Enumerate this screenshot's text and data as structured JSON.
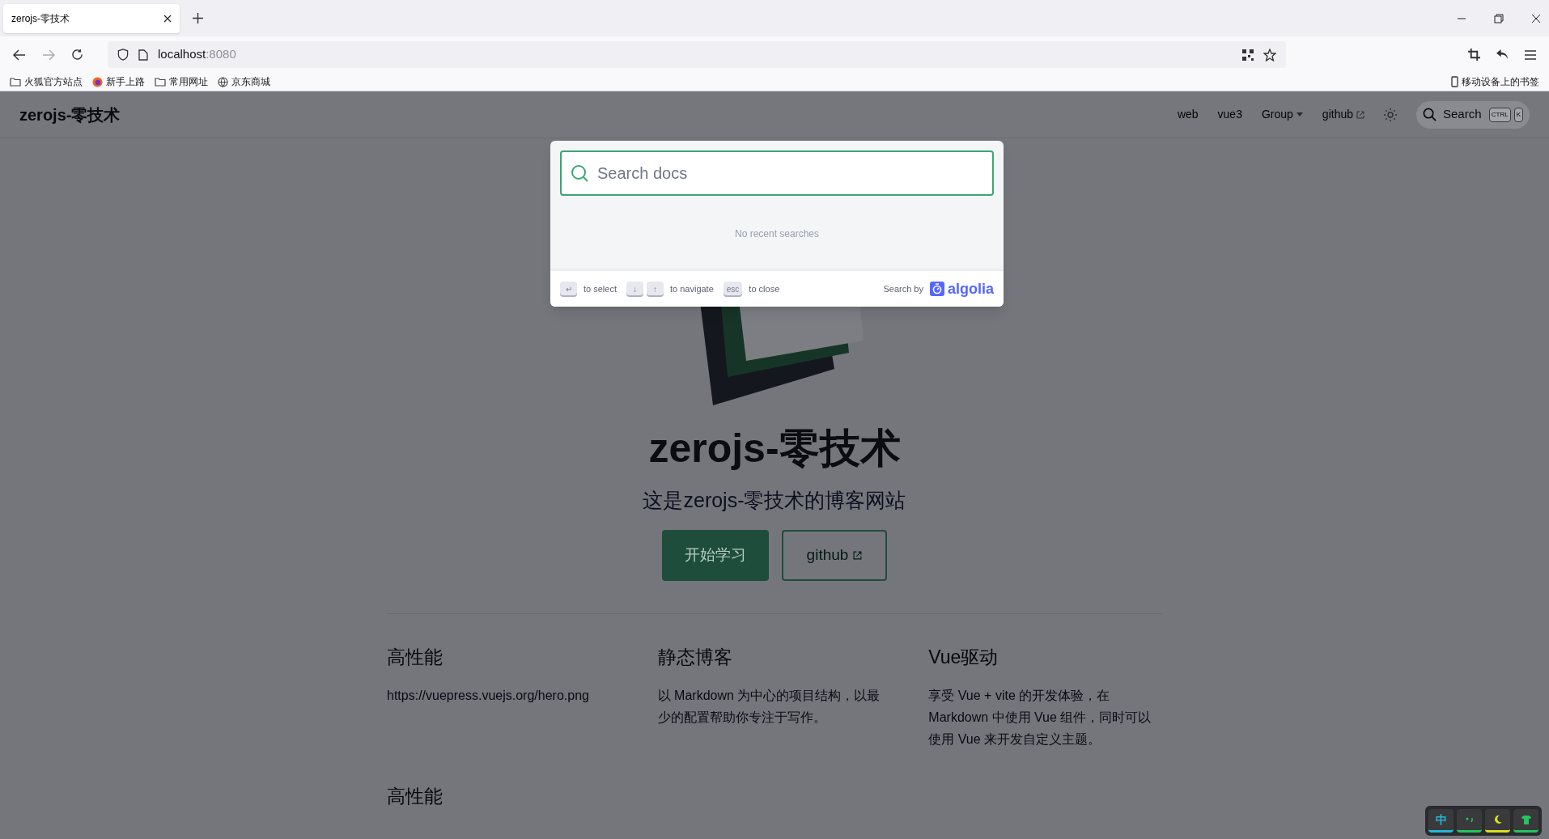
{
  "browser": {
    "tab": {
      "title": "zerojs-零技术"
    },
    "address": {
      "host": "localhost",
      "port": ":8080"
    },
    "bookmarks": [
      {
        "label": "火狐官方站点",
        "kind": "folder"
      },
      {
        "label": "新手上路",
        "kind": "firefox"
      },
      {
        "label": "常用网址",
        "kind": "folder"
      },
      {
        "label": "京东商城",
        "kind": "globe"
      }
    ],
    "mobile_bookmarks": "移动设备上的书签"
  },
  "site": {
    "logo": "zerojs-零技术",
    "nav": [
      {
        "label": "web",
        "kind": "link"
      },
      {
        "label": "vue3",
        "kind": "link"
      },
      {
        "label": "Group",
        "kind": "dropdown"
      },
      {
        "label": "github",
        "kind": "external"
      }
    ],
    "search": {
      "placeholder": "Search",
      "keys": [
        "CTRL",
        "K"
      ]
    }
  },
  "hero": {
    "title": "zerojs-零技术",
    "tagline": "这是zerojs-零技术的博客网站",
    "actions": [
      {
        "label": "开始学习",
        "kind": "primary"
      },
      {
        "label": "github",
        "kind": "external"
      }
    ]
  },
  "features": [
    {
      "title": "高性能",
      "details": "https://vuepress.vuejs.org/hero.png"
    },
    {
      "title": "静态博客",
      "details": "以 Markdown 为中心的项目结构，以最少的配置帮助你专注于写作。"
    },
    {
      "title": "Vue驱动",
      "details": "享受 Vue + vite 的开发体验，在 Markdown 中使用 Vue 组件，同时可以使用 Vue 来开发自定义主题。"
    },
    {
      "title": "高性能"
    }
  ],
  "search_modal": {
    "placeholder": "Search docs",
    "empty": "No recent searches",
    "hints": [
      {
        "keys": [
          "↵"
        ],
        "label": "to select"
      },
      {
        "keys": [
          "↓",
          "↑"
        ],
        "label": "to navigate"
      },
      {
        "keys": [
          "esc"
        ],
        "label": "to close"
      }
    ],
    "search_by": "Search by",
    "brand": "algolia"
  },
  "ime_toolbar": [
    {
      "kind": "text",
      "label": "中",
      "color": "#22b8d8"
    },
    {
      "kind": "punctuation",
      "color": "#22c55e"
    },
    {
      "kind": "moon",
      "color": "#d9e021"
    },
    {
      "kind": "shirt",
      "color": "#22c55e"
    }
  ]
}
